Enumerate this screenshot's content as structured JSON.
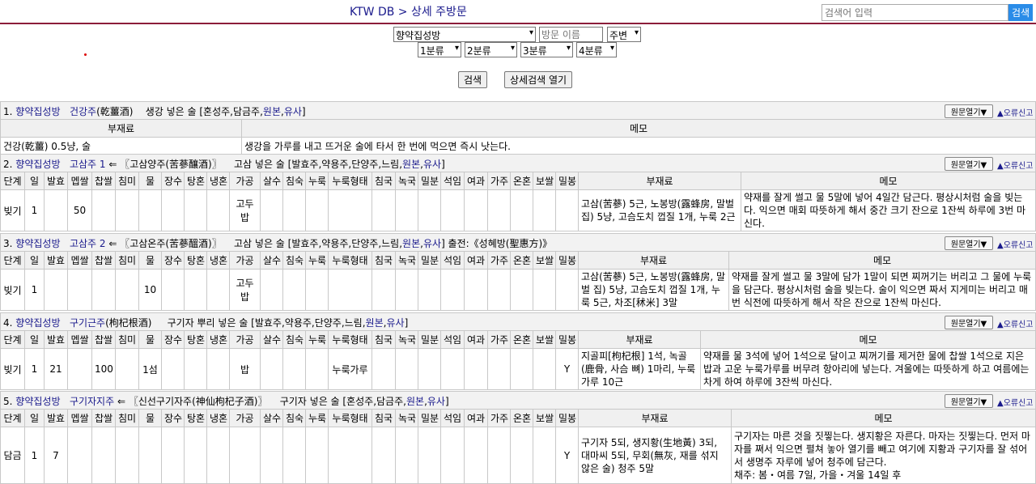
{
  "header": {
    "breadcrumb_site": "KTW DB",
    "breadcrumb_sep": ">",
    "breadcrumb_page": "상세 주방문",
    "search_placeholder": "검색어 입력",
    "search_button": "검색"
  },
  "filters": {
    "source": "향약집성방",
    "name_placeholder": "방문 이름",
    "type": "주변",
    "cat1": "1분류",
    "cat2": "2분류",
    "cat3": "3분류",
    "cat4": "4분류",
    "search_button": "검색",
    "advanced_button": "상세검색 열기"
  },
  "common": {
    "original_button": "원문열기▼",
    "report_link": "오류신고",
    "col_ingredients": "부재료",
    "col_memo": "메모"
  },
  "columns": [
    "단계",
    "일",
    "발효",
    "멥쌀",
    "찹쌀",
    "침미",
    "물",
    "장수",
    "탕혼",
    "냉혼",
    "가공",
    "살수",
    "침숙",
    "누룩",
    "누룩형태",
    "침국",
    "녹국",
    "밀분",
    "석임",
    "여과",
    "가주",
    "온혼",
    "보쌀",
    "밀봉",
    "부재료",
    "메모"
  ],
  "entries": [
    {
      "num": "1.",
      "source": "향약집성방",
      "name": "건강주",
      "hanja": "(乾薑酒)",
      "arrow": "",
      "alias": "",
      "desc": "생강 넣은 술 [혼성주,담금주,",
      "src1": "원본",
      "src2": "유사",
      "tail": "]",
      "ingredients": "건강(乾薑) 0.5냥, 술",
      "memo": "생강을 가루를 내고 뜨거운 술에 타서 한 번에 먹으면 즉시 낫는다."
    },
    {
      "num": "2.",
      "source": "향약집성방",
      "name": "고삼주 1",
      "hanja": "",
      "arrow": "⇐ 〖고삼양주(苦蔘釀酒)〗",
      "alias": "",
      "desc": "고삼 넣은 술 [발효주,약용주,단양주,느림,",
      "src1": "원본",
      "src2": "유사",
      "tail": "]",
      "row": {
        "단계": "빚기",
        "일": "1",
        "멥쌀": "50",
        "가공": "고두밥"
      },
      "ingredients": "고삼(苦蔘) 5근, 노봉방(露蜂房, 말벌집) 5냥, 고슴도치 껍질 1개, 누룩 2근",
      "memo": "약재를 잘게 썰고 물 5말에 넣어 4일간 담근다. 평상시처럼 술을 빚는다. 익으면 매회 따뜻하게 해서 중간 크기 잔으로 1잔씩 하루에 3번 마신다."
    },
    {
      "num": "3.",
      "source": "향약집성방",
      "name": "고삼주 2",
      "hanja": "",
      "arrow": "⇐ 〖고삼온주(苦蔘醞酒)〗",
      "alias": "",
      "desc": "고삼 넣은 술 [발효주,약용주,단양주,느림,",
      "src1": "원본",
      "src2": "유사",
      "tail": "]  출전:《성혜방(聖惠方)》",
      "row": {
        "단계": "빚기",
        "일": "1",
        "물": "10",
        "가공": "고두밥"
      },
      "ingredients": "고삼(苦蔘) 5근, 노봉방(露蜂房, 말벌 집) 5냥, 고슴도치 껍질 1개, 누룩 5근, 차조[秫米] 3말",
      "memo": "약재를 잘게 썰고 물 3말에 담가 1말이 되면 찌꺼기는 버리고 그 물에 누룩을 담근다. 평상시처럼 술을 빚는다. 술이 익으면 짜서 지게미는 버리고 매번 식전에 따뜻하게 해서 작은 잔으로 1잔씩 마신다."
    },
    {
      "num": "4.",
      "source": "향약집성방",
      "name": "구기근주",
      "hanja": "(枸杞根酒)",
      "arrow": "",
      "alias": "",
      "desc": "구기자 뿌리 넣은 술 [발효주,약용주,단양주,느림,",
      "src1": "원본",
      "src2": "유사",
      "tail": "]",
      "row": {
        "단계": "빚기",
        "일": "1",
        "발효": "21",
        "찹쌀": "100",
        "물": "1섬",
        "가공": "밥",
        "누룩형태": "누룩가루",
        "밀봉": "Y"
      },
      "ingredients": "지골피[枸杞根] 1석, 녹골(鹿骨, 사슴 뼈) 1마리, 누룩가루 10근",
      "memo": "약재를 물 3석에 넣어 1석으로 달이고 찌꺼기를 제거한 물에 찹쌀 1석으로 지은 밥과 고운 누룩가루를 버무려 항아리에 넣는다. 겨울에는 따뜻하게 하고 여름에는 차게 하여 하루에 3잔씩 마신다."
    },
    {
      "num": "5.",
      "source": "향약집성방",
      "name": "구기자지주",
      "hanja": "",
      "arrow": "⇐ 〖신선구기자주(神仙枸杞子酒)〗",
      "alias": "",
      "desc": "구기자 넣은 술 [혼성주,담금주,",
      "src1": "원본",
      "src2": "유사",
      "tail": "]",
      "row": {
        "단계": "담금",
        "일": "1",
        "발효": "7",
        "밀봉": "Y"
      },
      "ingredients": "구기자 5되, 생지황(生地黃) 3되, 대마씨 5되, 무회(無灰, 재를 섞지 않은 술) 청주 5말",
      "memo": "구기자는 마른 것을 짓찧는다. 생지황은 자른다. 마자는 짓찧는다. 먼저 마자를 쪄서 익으면 펼쳐 놓아 열기를 빼고 여기에 지황과 구기자를 잘 섞어서 생명주 자루에 넣어 청주에 담근다.",
      "memo2": "채주: 봄・여름 7일, 가을・겨울 14일 후"
    }
  ]
}
